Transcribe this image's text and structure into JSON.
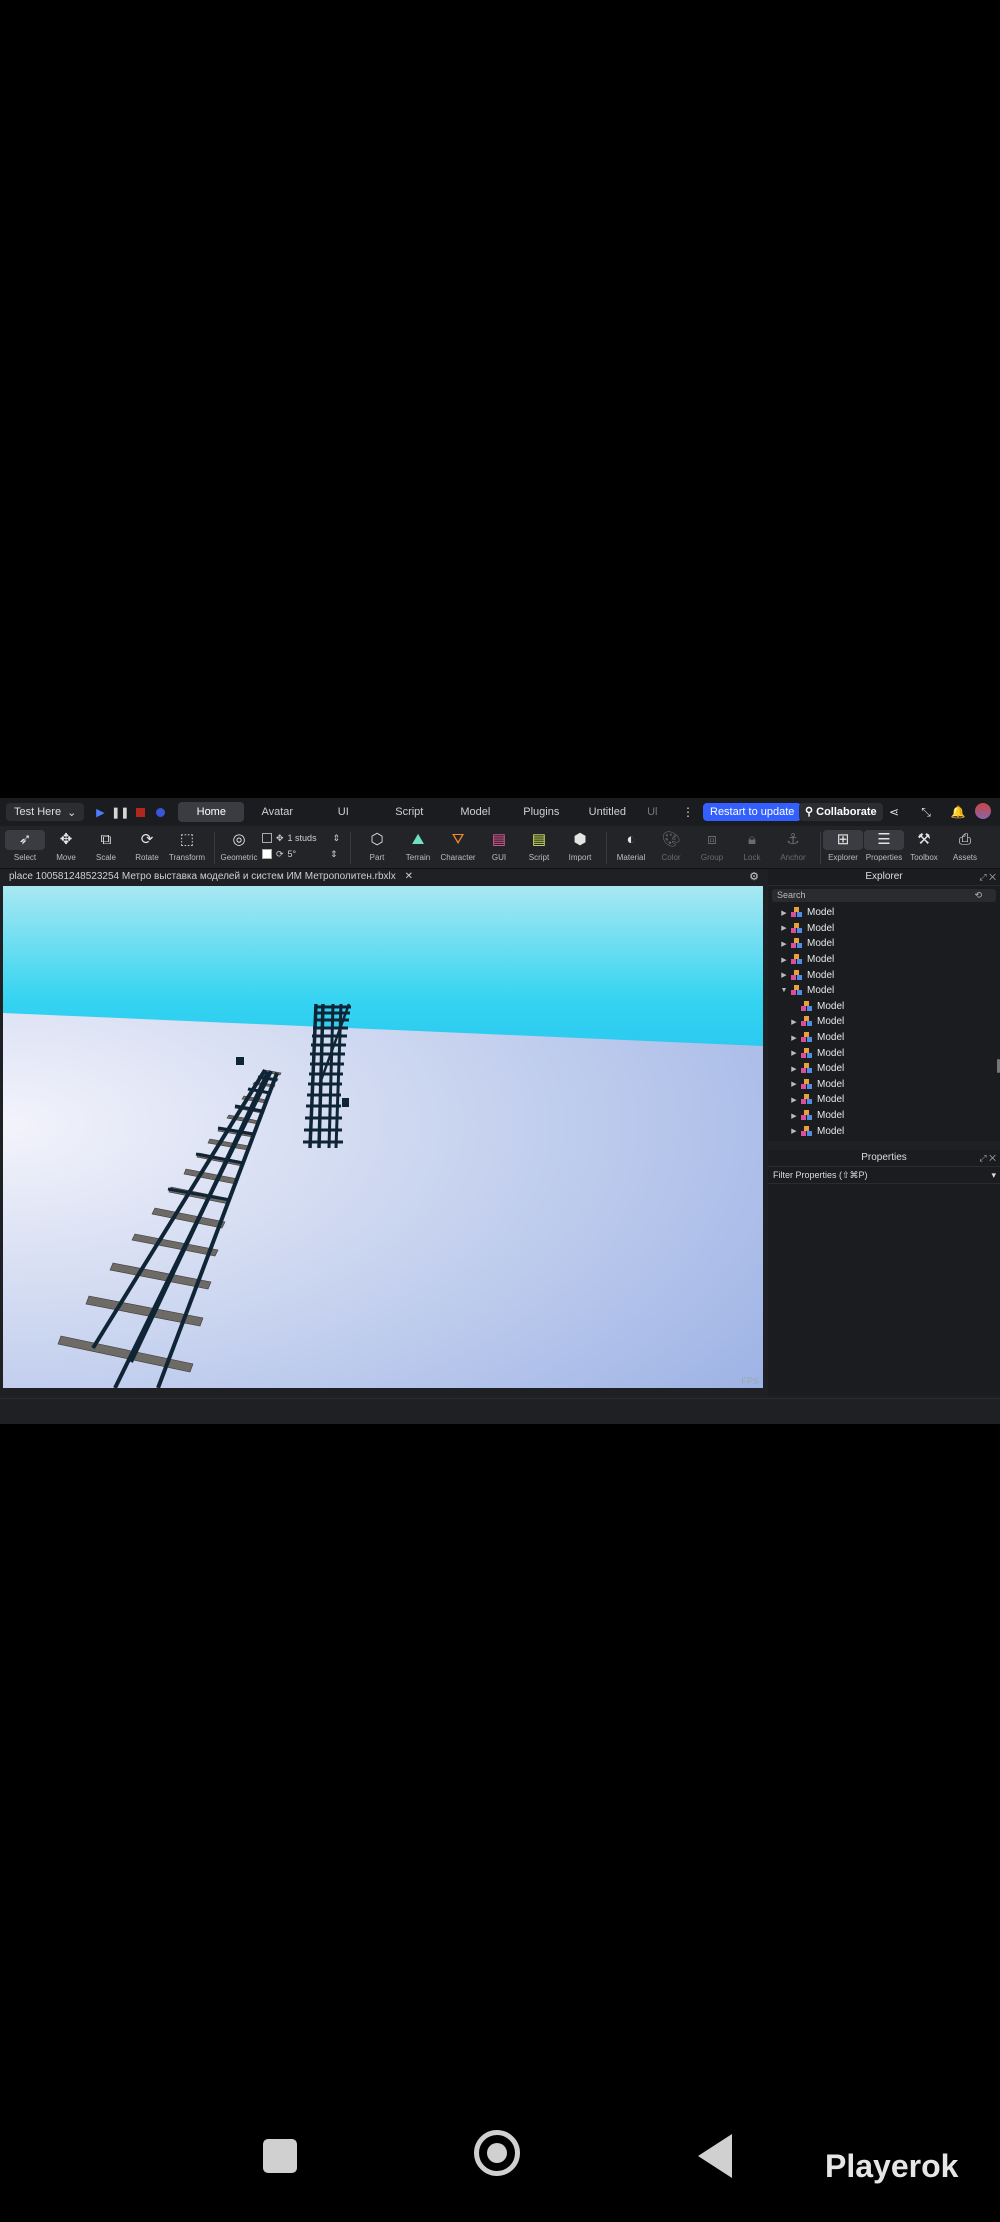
{
  "topbar": {
    "test_button": "Test Here",
    "tabs": [
      "Home",
      "Avatar",
      "UI",
      "Script",
      "Model",
      "Plugins",
      "Untitled",
      "Ul"
    ],
    "active_tab": "Home",
    "restart_label": "Restart to update",
    "collaborate_label": "Collaborate"
  },
  "toolbar": {
    "tools": [
      "Select",
      "Move",
      "Scale",
      "Rotate",
      "Transform",
      "Geometric"
    ],
    "snap_move": "1 studs",
    "snap_rotate": "5°",
    "insert": [
      "Part",
      "Terrain",
      "Character",
      "GUI",
      "Script",
      "Import"
    ],
    "edit": [
      "Material",
      "Color",
      "Group",
      "Lock",
      "Anchor"
    ],
    "windows": [
      "Explorer",
      "Properties",
      "Toolbox",
      "Assets"
    ]
  },
  "document": {
    "tab_title": "place 100581248523254 Метро выставка моделей и систем  ИМ Метрополитен.rbxlx"
  },
  "viewport": {
    "fps_label": "FPS"
  },
  "explorer": {
    "title": "Explorer",
    "search_placeholder": "Search",
    "items": [
      {
        "label": "Model",
        "level": 0,
        "expanded": false
      },
      {
        "label": "Model",
        "level": 0,
        "expanded": false
      },
      {
        "label": "Model",
        "level": 0,
        "expanded": false
      },
      {
        "label": "Model",
        "level": 0,
        "expanded": false
      },
      {
        "label": "Model",
        "level": 0,
        "expanded": false
      },
      {
        "label": "Model",
        "level": 0,
        "expanded": true
      },
      {
        "label": "Model",
        "level": 1,
        "expanded": null
      },
      {
        "label": "Model",
        "level": 1,
        "expanded": false
      },
      {
        "label": "Model",
        "level": 1,
        "expanded": false
      },
      {
        "label": "Model",
        "level": 1,
        "expanded": false
      },
      {
        "label": "Model",
        "level": 1,
        "expanded": false
      },
      {
        "label": "Model",
        "level": 1,
        "expanded": false
      },
      {
        "label": "Model",
        "level": 1,
        "expanded": false
      },
      {
        "label": "Model",
        "level": 1,
        "expanded": false
      },
      {
        "label": "Model",
        "level": 1,
        "expanded": false
      }
    ]
  },
  "properties": {
    "title": "Properties",
    "filter_label": "Filter Properties (⇧⌘P)"
  },
  "android": {
    "brand": "Playerok"
  },
  "colors": {
    "accent": "#335fff",
    "sky": "#38d3f0",
    "ground": "#c5d3ef",
    "track": "#0f2536"
  }
}
